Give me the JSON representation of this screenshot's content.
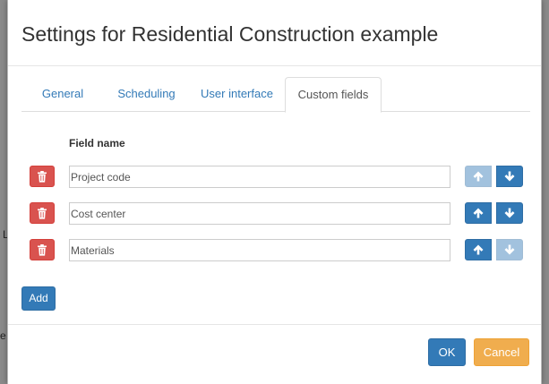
{
  "dialog": {
    "title": "Settings for Residential Construction example"
  },
  "tabs": [
    {
      "label": "General",
      "active": false
    },
    {
      "label": "Scheduling",
      "active": false
    },
    {
      "label": "User interface",
      "active": false
    },
    {
      "label": "Custom fields",
      "active": true
    }
  ],
  "custom_fields": {
    "column_header": "Field name",
    "rows": [
      {
        "value": "Project code",
        "move_up_enabled": false,
        "move_down_enabled": true
      },
      {
        "value": "Cost center",
        "move_up_enabled": true,
        "move_down_enabled": true
      },
      {
        "value": "Materials",
        "move_up_enabled": true,
        "move_down_enabled": false
      }
    ],
    "add_label": "Add"
  },
  "footer": {
    "ok_label": "OK",
    "cancel_label": "Cancel"
  },
  "colors": {
    "primary": "#337ab7",
    "danger": "#d9534f",
    "warning": "#f0ad4e"
  },
  "icons": {
    "delete": "trash-icon",
    "move_up": "arrow-up-icon",
    "move_down": "arrow-down-icon"
  }
}
